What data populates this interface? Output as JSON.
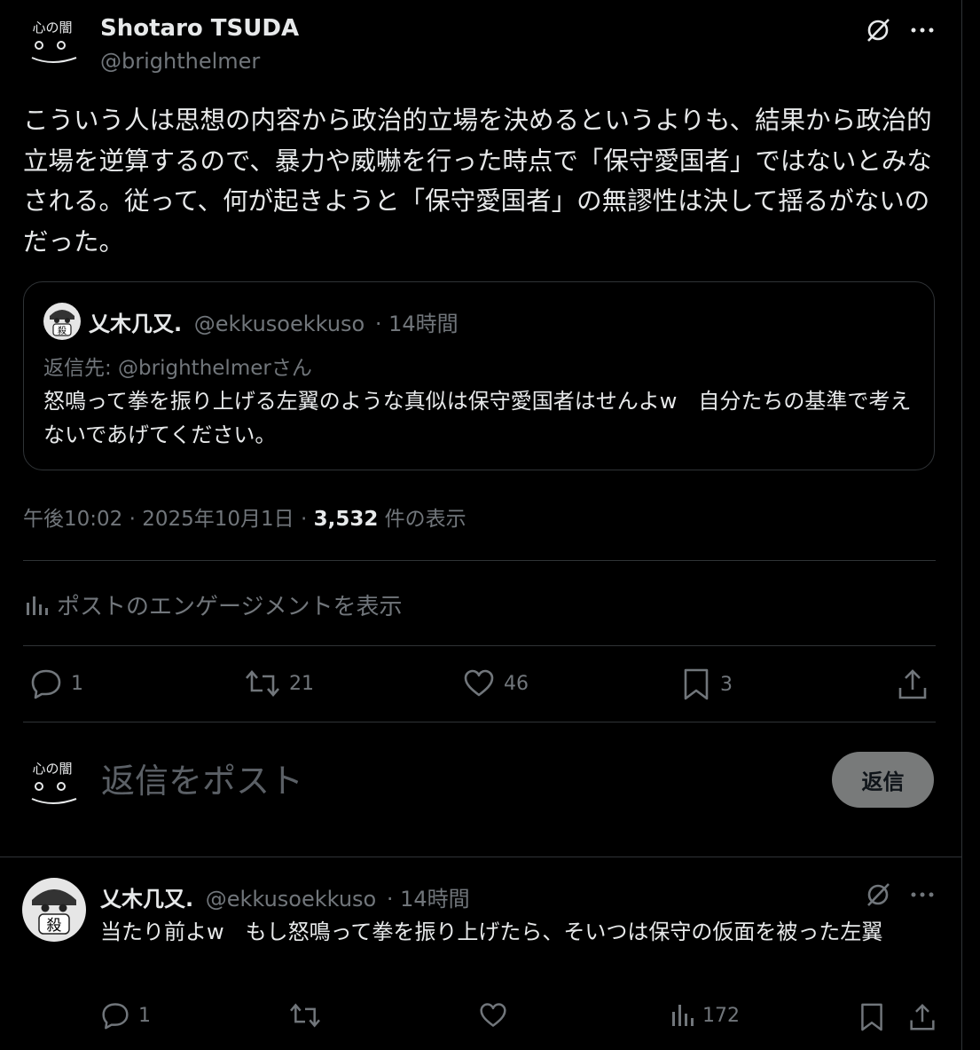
{
  "main_post": {
    "author_name": "Shotaro TSUDA",
    "author_handle": "@brighthelmer",
    "avatar_text": "心の闇",
    "text": "こういう人は思想の内容から政治的立場を決めるというよりも、結果から政治的立場を逆算するので、暴力や威嚇を行った時点で「保守愛国者」ではないとみなされる。従って、何が起きようと「保守愛国者」の無謬性は決して揺るがないのだった。",
    "timestamp": "午後10:02 · 2025年10月1日 · ",
    "views_count": "3,532",
    "views_label": " 件の表示",
    "engagement_link": "ポストのエンゲージメントを表示",
    "actions": {
      "replies": "1",
      "reposts": "21",
      "likes": "46",
      "bookmarks": "3"
    }
  },
  "quoted_post": {
    "author_name": "乂木几又.",
    "author_handle": "@ekkusoekkuso",
    "time": "· 14時間",
    "reply_to": "返信先: @brighthelmerさん",
    "text": "怒鳴って拳を振り上げる左翼のような真似は保守愛国者はせんよw　自分たちの基準で考えないであげてください。",
    "avatar_text": "殺"
  },
  "reply_box": {
    "placeholder": "返信をポスト",
    "button_label": "返信"
  },
  "reply_post": {
    "author_name": "乂木几又.",
    "author_handle": "@ekkusoekkuso",
    "time": "· 14時間",
    "text": "当たり前よw　もし怒鳴って拳を振り上げたら、そいつは保守の仮面を被った左翼",
    "avatar_text": "殺",
    "actions": {
      "replies": "1",
      "views": "172"
    }
  },
  "colors": {
    "background": "#000000",
    "text": "#e7e9ea",
    "muted": "#71767b",
    "border": "#2f3336",
    "reply_button": "#787a7a"
  }
}
